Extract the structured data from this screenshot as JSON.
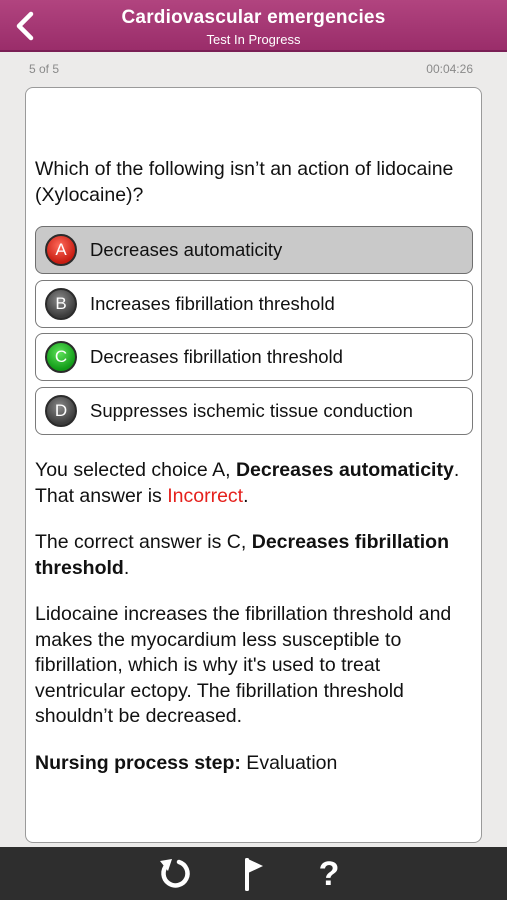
{
  "header": {
    "title": "Cardiovascular emergencies",
    "subtitle": "Test In Progress",
    "back_icon": "chevron-left-icon"
  },
  "progress": {
    "counter": "5 of 5",
    "timer": "00:04:26"
  },
  "question": {
    "text": "Which of the following isn’t an action of lidocaine (Xylocaine)?"
  },
  "choices": [
    {
      "letter": "A",
      "text": "Decreases automaticity",
      "badge_color": "#c81d12",
      "state": "selected-incorrect"
    },
    {
      "letter": "B",
      "text": "Increases fibrillation threshold",
      "badge_color": "#3c3c3c",
      "state": "unselected"
    },
    {
      "letter": "C",
      "text": "Decreases fibrillation threshold",
      "badge_color": "#119a17",
      "state": "correct"
    },
    {
      "letter": "D",
      "text": "Suppresses ischemic tissue conduction",
      "badge_color": "#3c3c3c",
      "state": "unselected"
    }
  ],
  "feedback": {
    "selected_prefix": "You selected choice A, ",
    "selected_choice": "Decreases automaticity",
    "selected_mid": ". That answer is ",
    "result": "Incorrect",
    "selected_end": ".",
    "correct_prefix": "The correct answer is C, ",
    "correct_choice": "Decreases fibrillation threshold",
    "correct_end": ".",
    "rationale": "Lidocaine increases the fibrillation threshold and makes the myocardium less susceptible to fibrillation, which is why it's used to treat ventricular ectopy. The fibrillation threshold shouldn’t be decreased.",
    "step_label": "Nursing process step:",
    "step_value": " Evaluation"
  },
  "toolbar": {
    "reset_icon": "refresh-icon",
    "flag_icon": "flag-icon",
    "help_label": "?"
  },
  "colors": {
    "header": "#9a2d6a",
    "incorrect": "#e5201c",
    "footer": "#2e2e2e"
  }
}
